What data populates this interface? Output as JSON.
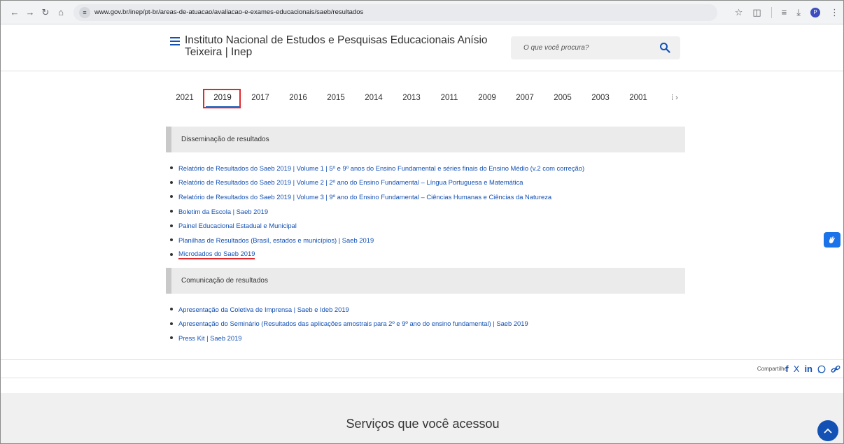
{
  "browser": {
    "url": "www.gov.br/inep/pt-br/areas-de-atuacao/avaliacao-e-exames-educacionais/saeb/resultados",
    "profile_initial": "P"
  },
  "header": {
    "title": "Instituto Nacional de Estudos e Pesquisas Educacionais Anísio Teixeira | Inep",
    "search_placeholder": "O que você procura?"
  },
  "years": {
    "items": [
      "2021",
      "2019",
      "2017",
      "2016",
      "2015",
      "2014",
      "2013",
      "2011",
      "2009",
      "2007",
      "2005",
      "2003",
      "2001"
    ],
    "active": "2019",
    "more_glyph": "›"
  },
  "sections": [
    {
      "title": "Disseminação de resultados",
      "links": [
        "Relatório de Resultados do Saeb 2019 | Volume 1 | 5º e 9º anos do Ensino Fundamental e séries finais do Ensino Médio (v.2 com correção)",
        "Relatório de Resultados do Saeb 2019 | Volume 2 | 2º ano do Ensino Fundamental – Língua Portuguesa e Matemática",
        "Relatório de Resultados do Saeb 2019 | Volume 3 | 9º ano do Ensino Fundamental – Ciências Humanas e Ciências da Natureza",
        "Boletim da Escola | Saeb 2019",
        "Painel Educacional Estadual e Municipal",
        "Planilhas de Resultados (Brasil, estados e municípios) | Saeb 2019",
        "Microdados do Saeb 2019"
      ]
    },
    {
      "title": "Comunicação de resultados",
      "links": [
        "Apresentação da Coletiva de Imprensa | Saeb e Ideb 2019",
        "Apresentação do Seminário (Resultados das aplicações amostrais para 2º e 9º ano do ensino fundamental) | Saeb 2019",
        "Press Kit | Saeb 2019"
      ]
    }
  ],
  "share": {
    "label": "Compartilhe",
    "facebook": "f",
    "x": "X",
    "linkedin": "in"
  },
  "footer": {
    "services_title": "Serviços que você acessou"
  },
  "colors": {
    "accent": "#1351b4",
    "highlight": "#e0282e"
  }
}
